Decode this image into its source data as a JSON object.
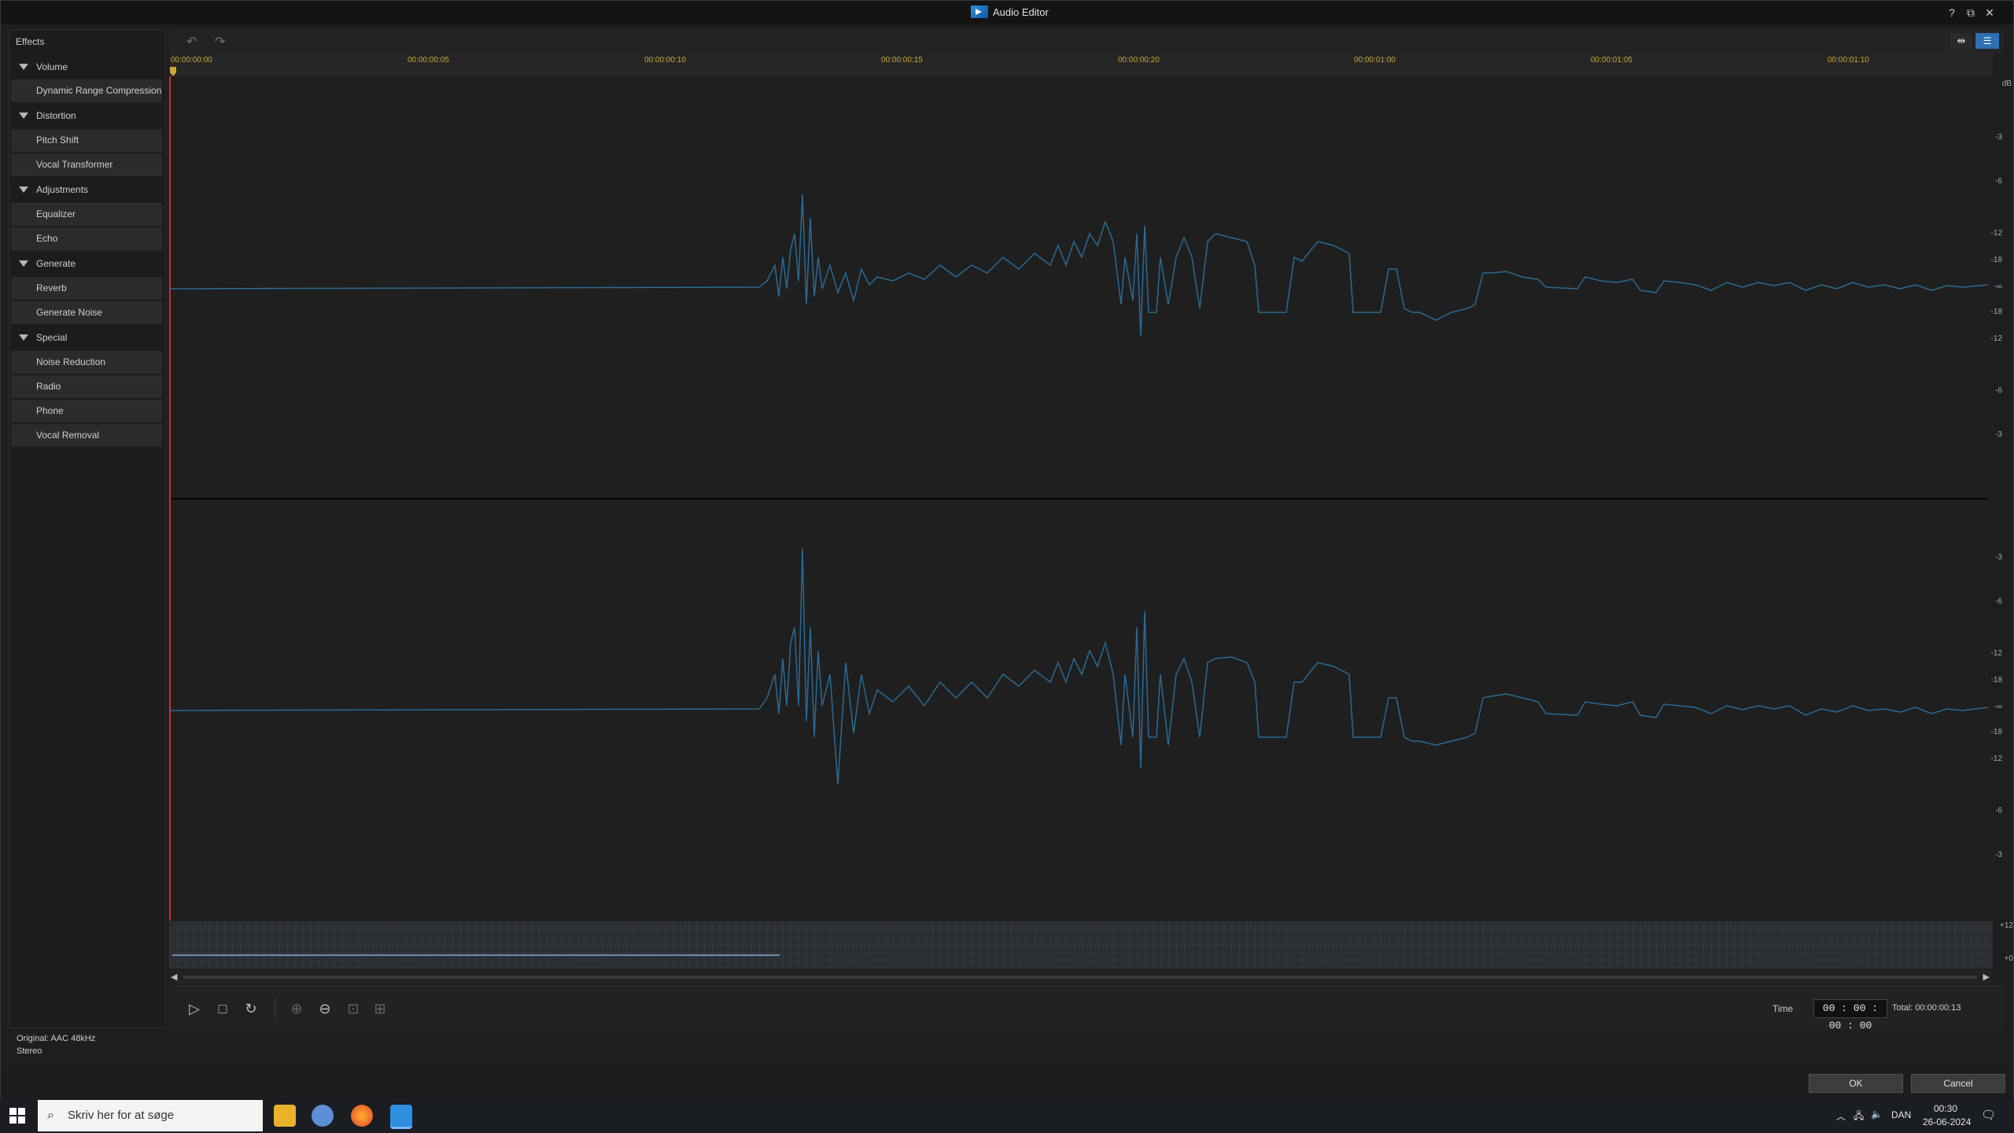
{
  "window": {
    "title": "Audio Editor",
    "help": "?",
    "restore": "⧉",
    "close": "✕"
  },
  "sidebar": {
    "title": "Effects",
    "groups": [
      {
        "label": "Volume",
        "items": [
          "Dynamic Range Compression"
        ]
      },
      {
        "label": "Distortion",
        "items": [
          "Pitch Shift",
          "Vocal Transformer"
        ]
      },
      {
        "label": "Adjustments",
        "items": [
          "Equalizer",
          "Echo"
        ]
      },
      {
        "label": "Generate",
        "items": [
          "Reverb",
          "Generate Noise"
        ]
      },
      {
        "label": "Special",
        "items": [
          "Noise Reduction",
          "Radio",
          "Phone",
          "Vocal Removal"
        ]
      }
    ]
  },
  "toolbar": {
    "undo_icon": "undo-icon",
    "redo_icon": "redo-icon"
  },
  "ruler": {
    "labels": [
      "00:00:00:00",
      "00:00:00:05",
      "00:00:00:10",
      "00:00:00:15",
      "00:00:00:20",
      "00:00:01:00",
      "00:00:01:05",
      "00:00:01:10"
    ]
  },
  "db_scale": {
    "unit": "dB",
    "top": [
      "-3",
      "-6",
      "-12",
      "-18",
      "-∞",
      "-18",
      "-12",
      "-6",
      "-3"
    ],
    "bottom": [
      "-3",
      "-6",
      "-12",
      "-18",
      "-∞",
      "-18",
      "-12",
      "-6",
      "-3"
    ],
    "overview": [
      "+12",
      "+0"
    ]
  },
  "transport": {
    "time_label": "Time",
    "time_value": "00 : 00 : 00 : 00",
    "total": "Total: 00:00:00:13"
  },
  "status": {
    "line1": "Original: AAC 48kHz",
    "line2": "Stereo"
  },
  "buttons": {
    "ok": "OK",
    "cancel": "Cancel"
  },
  "taskbar": {
    "search_placeholder": "Skriv her for at søge",
    "lang": "DAN",
    "time": "00:30",
    "date": "26-06-2024"
  },
  "colors": {
    "accent": "#2d8fe0",
    "wave": "#2a6a96",
    "ruler_text": "#c9a53b",
    "playhead": "#d03030"
  }
}
